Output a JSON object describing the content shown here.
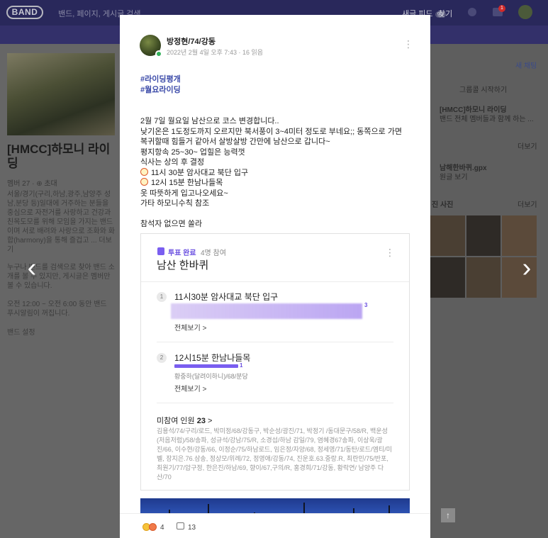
{
  "app": {
    "logo_text": "BAND",
    "search_placeholder": "밴드, 페이지, 게시글 검색",
    "nav": {
      "new_feed": "새글 피드",
      "new_feed_count": "99",
      "find": "찾기",
      "notification_count": "1"
    }
  },
  "background": {
    "band_title": "[HMCC]하모니 라이딩",
    "band_meta": "멤버 27 · ⊕ 초대",
    "band_description": "서울/경기(구리,하남,광주,남양주 성남,분당 등)일대에 거주하는 분들을 중심으로 자전거를 사랑하고 건강과 친목도모를 위해 모임을 가지는 밴드이며 서로 배려와 사랑으로 조화와 화합(harmony)을 통해 즐겁고 ... 더보기",
    "band_notice": "누구나 밴드를 검색으로 찾아 밴드 소개를 볼 수 있지만, 게시글은 멤버만 볼 수 있습니다.",
    "band_hours": "오전 12:00 ~ 오전 6:00 동안 밴드 푸시알림이 꺼집니다.",
    "band_settings": "밴드 설정",
    "right_new_chat": "새 채팅",
    "right_start_group": "그룹콜 시작하기",
    "right_chat_title": "[HMCC]하모니 라이딩",
    "right_chat_sub": "밴드 전체 멤버들과 함께 하는 ...",
    "right_more_1": "더보기",
    "right_file_name": "남해한바퀴.gpx",
    "right_file_sub": "원글 보기",
    "right_photos_title": "진 사진",
    "right_more_2": "더보기",
    "scroll_top": "↑"
  },
  "post": {
    "author": "방정현/74/강동",
    "meta": "2022년 2월 4일 오후 7:43 · 16 읽음",
    "hashtags": [
      "#라이딩평개",
      "#월요라이딩"
    ],
    "body": [
      "2월 7일 월요일 남산으로 코스 변경합니다..",
      "낮기온은 1도정도까지 오르지만 북서풍이 3~4미터 정도로 부네요;; 동쪽으로 가면",
      "복귀할때 힘들거 같아서 살방살방 간만에 남산으로 갑니다~",
      "평지항속 25~30~ 업힐은 능력껏",
      "식사는 상의 후 결정",
      "11시 30분 암사대교 북단 입구",
      "12시 15분 한남나들목",
      "옷 따뜻하게 입고나오세요~",
      "가타 하모니수칙 참조",
      "참석자 없으면 쏠라"
    ],
    "poll": {
      "status": "투표 완료",
      "participants": "4명 참여",
      "title": "남산 한바퀴",
      "options": [
        {
          "num": "1",
          "text": "11시30분 암사대교 북단 입구",
          "votes": "3",
          "share": 0.75,
          "voters": "",
          "see_all": "전체보기 >"
        },
        {
          "num": "2",
          "text": "12시15분 한남나들목",
          "votes": "1",
          "share": 0.25,
          "voters": "황중하(달려이하니)/68/분당",
          "see_all": "전체보기 >"
        }
      ],
      "absent_label": "미참여 인원",
      "absent_count": "23",
      "absent_list": "김용석/74/구리/로드, 박미정/68/강동구, 박순성/광진/71, 박정기 /동대문구/58/R, 백운성(저음저럼)/58/송파, 성규석/강남/75/R, 소경섭/하남 감일/79, 염혜경67송파, 이상욱/광진/66, 이수현/강동/66, 이정순/75/하남로드, 임은정/자양/68, 정세영/71/동탄/로드/엠티/미벨, 장지은.76.삼송, 정상모/위례/72, 정영애/강동/74, 진운호.63.중랑.R, 최란민/75/반포, 최원기/77/압구정, 한은진/하남/69, 향이/67,구의/R, 홍경희/71/강동, 황락연/ 남양주 다산/70"
    },
    "reactions": "4",
    "comments": "13"
  }
}
